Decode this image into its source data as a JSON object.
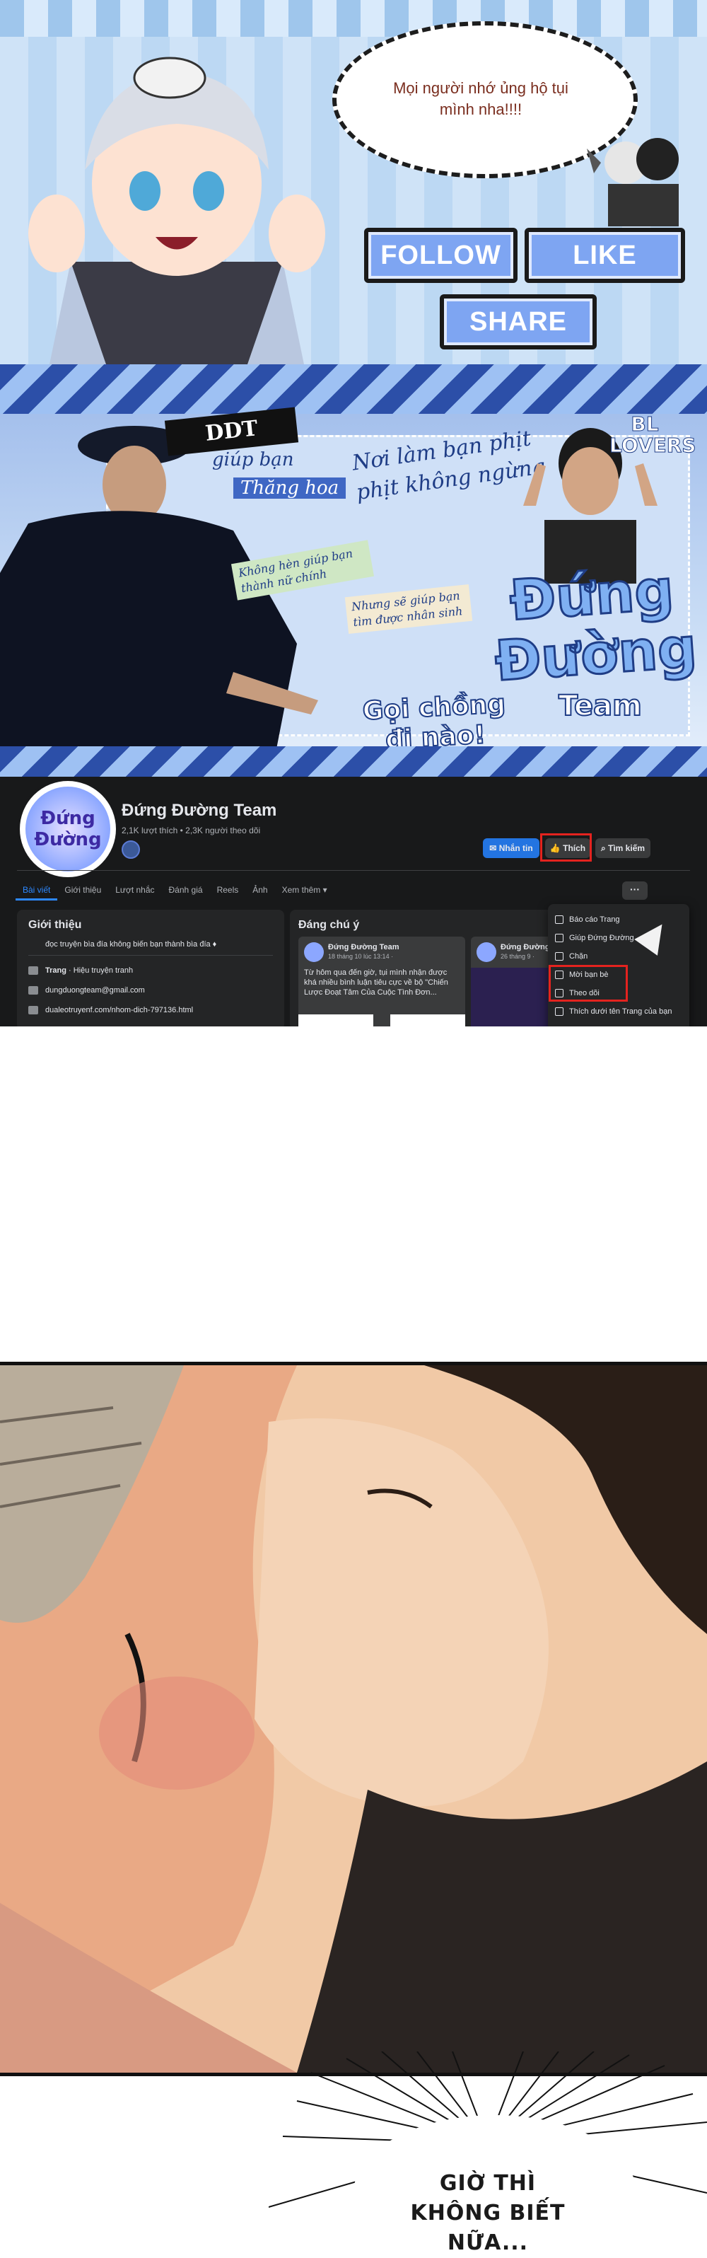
{
  "promo": {
    "speech": "Mọi người nhớ ủng hộ tụi mình nha!!!!",
    "follow_label": "FOLLOW",
    "like_label": "LIKE",
    "share_label": "SHARE",
    "colors": {
      "button_fill": "#7ea5f2",
      "stripe": "#9fc6ec"
    }
  },
  "cover": {
    "tag_ddt": "DDT",
    "tag_help": "giúp bạn",
    "tag_thang_hoa": "Thăng hoa",
    "note_1": "Nơi làm bạn phịt phịt không ngừng",
    "note_2": "Không hèn giúp bạn thành nữ chính",
    "note_3": "Nhưng sẽ giúp bạn tìm được nhân sinh",
    "logo_line1": "Đứng",
    "logo_line2": "Đường",
    "logo_team": "Team",
    "bl_lovers": "BL LOVERS",
    "call": "Gọi chồng đi nào!"
  },
  "facebook": {
    "page_name": "Đứng Đường Team",
    "stats": "2,1K lượt thích • 2,3K người theo dõi",
    "avatar_text": "Đứng Đường",
    "buttons": {
      "message": "Nhắn tin",
      "like": "Thích",
      "search": "Tìm kiếm",
      "more": "···"
    },
    "tabs": [
      {
        "label": "Bài viết"
      },
      {
        "label": "Giới thiệu"
      },
      {
        "label": "Lượt nhắc"
      },
      {
        "label": "Đánh giá"
      },
      {
        "label": "Reels"
      },
      {
        "label": "Ảnh"
      },
      {
        "label": "Xem thêm ▾"
      }
    ],
    "intro": {
      "heading": "Giới thiệu",
      "bio": "đọc truyện bìa đía không biến bạn thành bìa đía ♦",
      "category_prefix": "Trang",
      "category": " · Hiệu truyện tranh",
      "email": "dungduongteam@gmail.com",
      "link": "dualeotruyenf.com/nhom-dich-797136.html"
    },
    "featured": {
      "heading": "Đáng chú ý",
      "posts": [
        {
          "author": "Đứng Đường Team",
          "date": "18 tháng 10 lúc 13:14 ·",
          "text": "Từ hôm qua đến giờ, tụi mình nhận được khá nhiều bình luận tiêu cực về bộ \"Chiến Lược Đoạt Tâm Của Cuộc Tình Đơn..."
        },
        {
          "author": "Đứng Đường",
          "date": "26 tháng 9 ·",
          "text": ""
        }
      ]
    },
    "menu": [
      {
        "label": "Báo cáo Trang"
      },
      {
        "label": "Giúp Đứng Đường"
      },
      {
        "label": "Chặn"
      },
      {
        "label": "Mời bạn bè"
      },
      {
        "label": "Theo dõi"
      },
      {
        "label": "Thích dưới tên Trang của bạn"
      }
    ],
    "colors": {
      "background": "#18191a",
      "card": "#242526",
      "accent": "#2d88ff",
      "highlight": "#e4231f"
    }
  },
  "burst": {
    "text": "GIỜ THÌ KHÔNG BIẾT NỮA..."
  }
}
